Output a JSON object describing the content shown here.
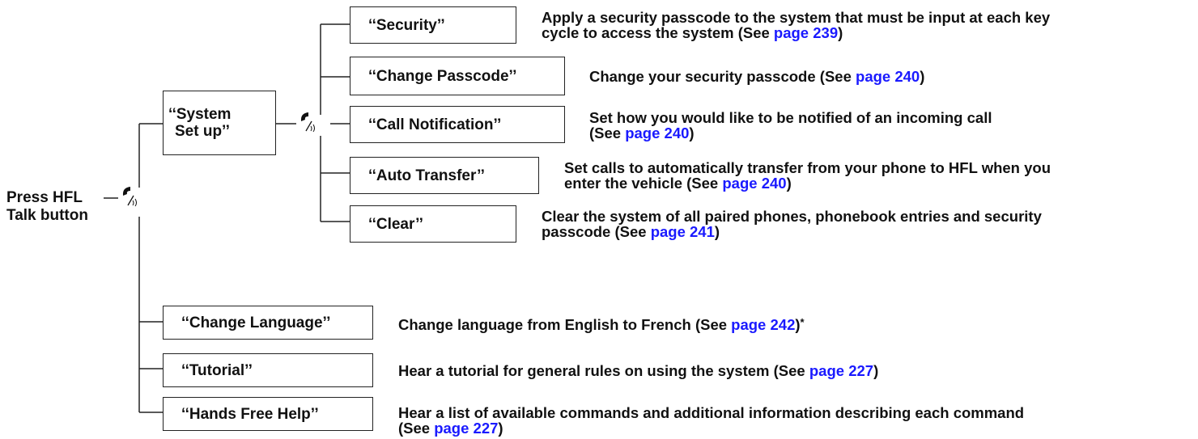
{
  "root": {
    "line1": "Press HFL",
    "line2": "Talk button"
  },
  "system_setup": {
    "line1": "‘‘System",
    "line2": "Set up’’"
  },
  "submenu": [
    {
      "label": "‘‘Security’’",
      "desc1": "Apply a security passcode to the system that must be input at each key",
      "desc2_pre": "cycle to access the system (See ",
      "link": "page 239",
      "desc2_post": ")"
    },
    {
      "label": "‘‘Change Passcode’’",
      "desc1_pre": "Change your security passcode (See ",
      "link": "page 240",
      "desc1_post": ")"
    },
    {
      "label": "‘‘Call Notification’’",
      "desc1": "Set how you would like to be notified of an incoming call",
      "desc2_pre": "(See ",
      "link": "page 240",
      "desc2_post": ")"
    },
    {
      "label": "‘‘Auto Transfer’’",
      "desc1": "Set calls to automatically transfer from your phone to HFL when you",
      "desc2_pre": "enter the vehicle (See ",
      "link": "page 240",
      "desc2_post": ")"
    },
    {
      "label": "‘‘Clear’’",
      "desc1": "Clear the system of all paired phones, phonebook entries and security",
      "desc2_pre": "passcode (See ",
      "link": "page 241",
      "desc2_post": ")"
    }
  ],
  "main": [
    {
      "label": "‘‘Change Language’’",
      "desc1_pre": "Change language from English to French  (See ",
      "link": "page 242",
      "desc1_post": ")",
      "mark": "*"
    },
    {
      "label": "‘‘Tutorial’’",
      "desc1_pre": "Hear a tutorial for general rules on using the system (See ",
      "link": "page 227",
      "desc1_post": ")"
    },
    {
      "label": "‘‘Hands Free Help’’",
      "desc1": "Hear a list of available commands and additional information describing each command",
      "desc2_pre": "(See ",
      "link": "page 227",
      "desc2_post": ")"
    }
  ],
  "icons": {
    "talk": "talk-button-icon"
  },
  "colors": {
    "link": "#1a1aff",
    "text": "#111111"
  }
}
